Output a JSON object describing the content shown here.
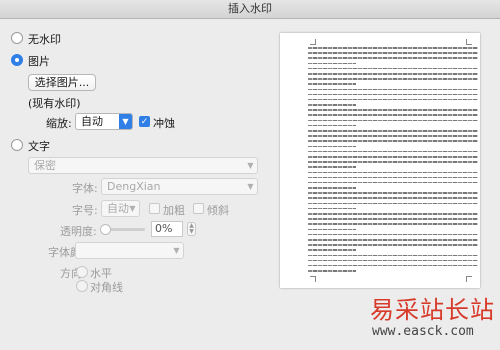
{
  "window": {
    "title": "插入水印"
  },
  "options": {
    "no_watermark": "无水印",
    "picture": "图片",
    "select_picture_button": "选择图片...",
    "current_watermark": "(现有水印)",
    "scale_label": "缩放:",
    "scale_value": "自动",
    "washout_label": "冲蚀",
    "text": "文字"
  },
  "text_settings": {
    "text_value": "保密",
    "font_label": "字体:",
    "font_value": "DengXian",
    "size_label": "字号:",
    "size_value": "自动",
    "bold_label": "加粗",
    "italic_label": "倾斜",
    "transparency_label": "透明度:",
    "transparency_value": "0%",
    "font_color_label": "字体颜色:",
    "direction_label": "方向:",
    "horizontal_label": "水平",
    "diagonal_label": "对角线"
  },
  "overlay": {
    "site_name": "易采站长站",
    "site_url": "www.easck.com"
  },
  "colors": {
    "accent": "#2f7fe6",
    "watermark_red": "#d83a2a"
  },
  "icons": {
    "dropdown": "chevron-down-icon",
    "stepper": "stepper-icon",
    "check": "checkmark-icon"
  }
}
